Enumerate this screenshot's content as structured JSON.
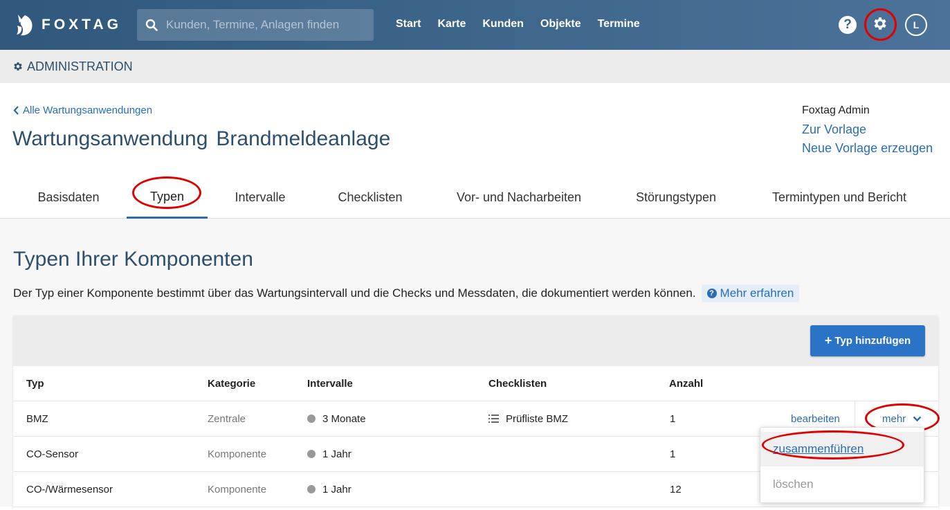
{
  "topbar": {
    "brand": "FOXTAG",
    "search_placeholder": "Kunden, Termine, Anlagen finden",
    "nav": [
      "Start",
      "Karte",
      "Kunden",
      "Objekte",
      "Termine"
    ],
    "help": "?",
    "avatar": "L"
  },
  "adminbar": {
    "title": "ADMINISTRATION"
  },
  "header": {
    "back_link": "Alle Wartungsanwendungen",
    "title": "Wartungsanwendung",
    "subtitle": "Brandmeldeanlage",
    "owner": "Foxtag Admin",
    "link_template": "Zur Vorlage",
    "link_new_template": "Neue Vorlage erzeugen"
  },
  "tabs": [
    "Basisdaten",
    "Typen",
    "Intervalle",
    "Checklisten",
    "Vor- und Nacharbeiten",
    "Störungstypen",
    "Termintypen und Bericht"
  ],
  "active_tab": "Typen",
  "section": {
    "title": "Typen Ihrer Komponenten",
    "description": "Der Typ einer Komponente bestimmt über das Wartungsintervall und die Checks und Messdaten, die dokumentiert werden können.",
    "learn_more": "Mehr erfahren"
  },
  "table": {
    "add_button": "Typ hinzufügen",
    "columns": [
      "Typ",
      "Kategorie",
      "Intervalle",
      "Checklisten",
      "Anzahl"
    ],
    "rows": [
      {
        "typ": "BMZ",
        "kategorie": "Zentrale",
        "intervall": "3 Monate",
        "checkliste": "Prüfliste BMZ",
        "anzahl": "1",
        "edit": "bearbeiten",
        "more": "mehr"
      },
      {
        "typ": "CO-Sensor",
        "kategorie": "Komponente",
        "intervall": "1 Jahr",
        "checkliste": "",
        "anzahl": "1"
      },
      {
        "typ": "CO-/Wärmesensor",
        "kategorie": "Komponente",
        "intervall": "1 Jahr",
        "checkliste": "",
        "anzahl": "12"
      }
    ]
  },
  "dropdown": {
    "merge": "zusammenführen",
    "delete": "löschen"
  },
  "colors": {
    "nav_start": "#2f587c",
    "nav_end": "#4b7399",
    "link": "#2a6db5",
    "primary_button": "#2a73c6",
    "highlight": "#e00000"
  }
}
